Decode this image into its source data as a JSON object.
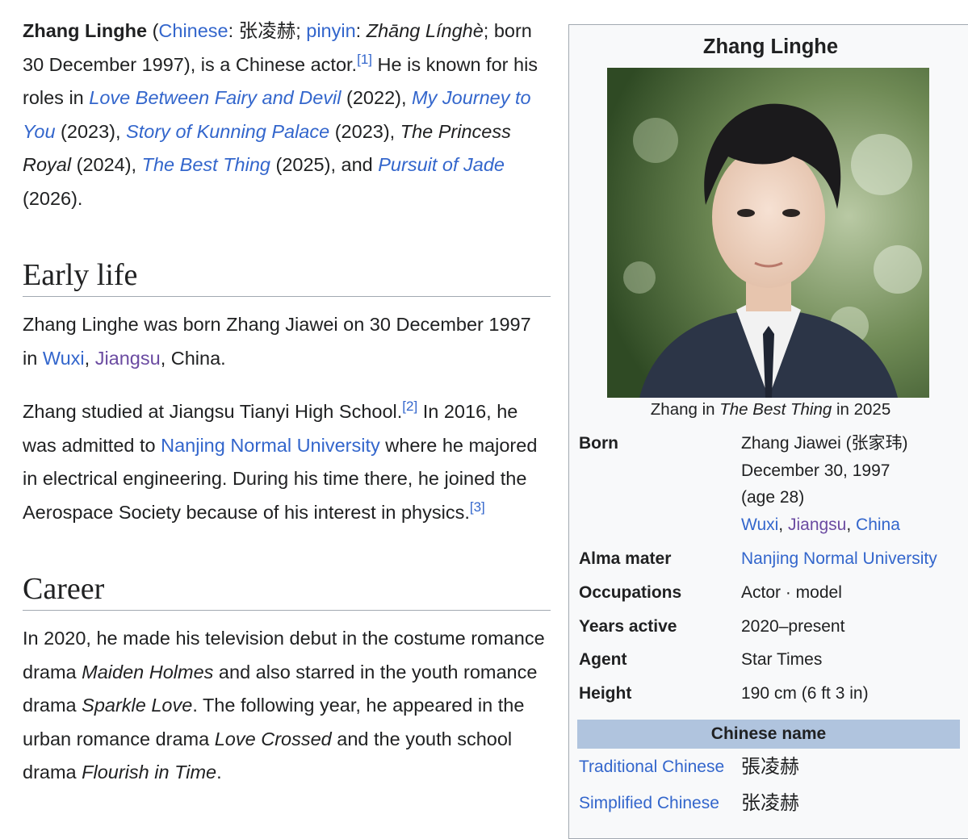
{
  "intro": {
    "name": "Zhang Linghe",
    "t1": " (",
    "chinese_link": "Chinese",
    "t2": ": 张凌赫; ",
    "pinyin_link": "pinyin",
    "t3": ": ",
    "pinyin_value": "Zhāng Línghè",
    "t4": "; born 30 December 1997), is a Chinese actor.",
    "ref1": "[1]",
    "t5": " He is known for his roles in ",
    "work1": "Love Between Fairy and Devil",
    "t6": " (2022), ",
    "work2": "My Journey to You",
    "t7": " (2023), ",
    "work3": "Story of Kunning Palace",
    "t8": " (2023), ",
    "work4": "The Princess Royal",
    "t9": " (2024), ",
    "work5": "The Best Thing",
    "t10": " (2025), and ",
    "work6": "Pursuit of Jade",
    "t11": " (2026)."
  },
  "early_life": {
    "heading": "Early life",
    "p1_a": "Zhang Linghe was born Zhang Jiawei on 30 December 1997 in ",
    "wuxi": "Wuxi",
    "comma": ", ",
    "jiangsu": "Jiangsu",
    "p1_b": ", China.",
    "p2_a": "Zhang studied at Jiangsu Tianyi High School.",
    "ref2": "[2]",
    "p2_b": " In 2016, he was admitted to ",
    "nnu": "Nanjing Normal University",
    "p2_c": " where he majored in electrical engineering. During his time there, he joined the Aerospace Society because of his interest in physics.",
    "ref3": "[3]"
  },
  "career": {
    "heading": "Career",
    "p1_a": "In 2020, he made his television debut in the costume romance drama ",
    "w1": "Maiden Holmes",
    "p1_b": " and also starred in the youth romance drama ",
    "w2": "Sparkle Love",
    "p1_c": ". The following year, he appeared in the urban romance drama ",
    "w3": "Love Crossed",
    "p1_d": " and the youth school drama ",
    "w4": "Flourish in Time",
    "p1_e": "."
  },
  "infobox": {
    "title": "Zhang Linghe",
    "caption_a": "Zhang in ",
    "caption_work": "The Best Thing",
    "caption_b": " in 2025",
    "born_label": "Born",
    "born_name": "Zhang Jiawei (张家玮)",
    "born_date": "December 30, 1997",
    "born_age": "(age 28)",
    "born_place1": "Wuxi",
    "born_place2": "Jiangsu",
    "born_place3": "China",
    "sep": ", ",
    "alma_label": "Alma mater",
    "alma_value": "Nanjing Normal University",
    "occ_label": "Occupations",
    "occ_value": "Actor · model",
    "years_label": "Years active",
    "years_value": "2020–present",
    "agent_label": "Agent",
    "agent_value": "Star Times",
    "height_label": "Height",
    "height_value": "190 cm (6 ft 3 in)",
    "cn_header": "Chinese name",
    "trad_label": "Traditional Chinese",
    "trad_value": "張凌赫",
    "simp_label": "Simplified Chinese",
    "simp_value": "张凌赫"
  },
  "colors": {
    "link": "#3366cc",
    "visited": "#6b4ba1",
    "header_bar": "#b0c4de",
    "infobox_bg": "#f8f9fa"
  }
}
